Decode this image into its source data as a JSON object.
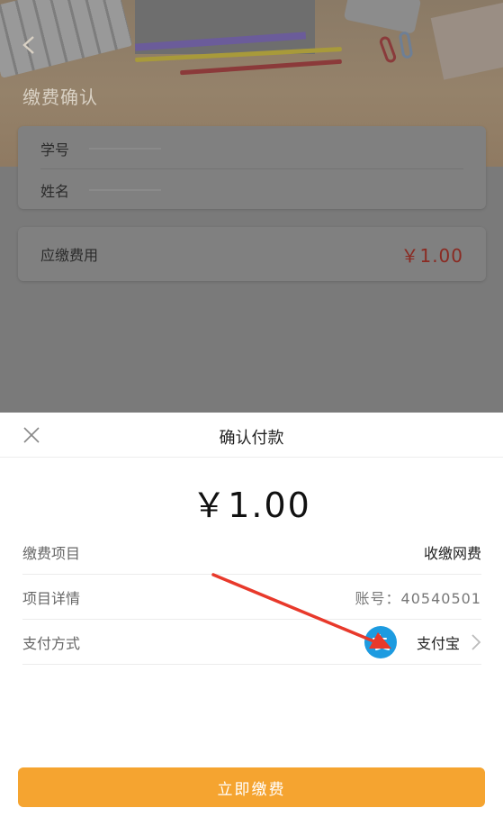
{
  "page": {
    "title": "缴费确认",
    "fields": [
      {
        "label": "学号"
      },
      {
        "label": "姓名"
      }
    ],
    "fee_label": "应缴费用",
    "fee_amount": "￥1.00"
  },
  "sheet": {
    "title": "确认付款",
    "amount": "￥1.00",
    "rows": [
      {
        "label": "缴费项目",
        "value": "收缴网费"
      },
      {
        "label": "项目详情",
        "value": "账号：40540501"
      },
      {
        "label": "支付方式",
        "value": "支付宝"
      }
    ],
    "pay_button": "立即缴费"
  },
  "icons": {
    "back": "back-arrow-icon",
    "close": "close-icon",
    "payment": "alipay-icon",
    "chevron": "chevron-right-icon"
  },
  "colors": {
    "accent": "#f5a430",
    "price": "#e0312a",
    "alipay": "#1d9be0",
    "annotation_arrow": "#e8392b"
  }
}
